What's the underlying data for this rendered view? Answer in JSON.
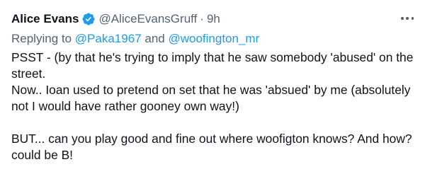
{
  "tweet": {
    "display_name": "Alice Evans",
    "handle": "@AliceEvansGruff",
    "separator": "·",
    "time": "9h",
    "reply_prefix": "Replying to",
    "reply_mention_1": "@Paka1967",
    "reply_and": "and",
    "reply_mention_2": "@woofington_mr",
    "paragraphs": [
      "PSST  - (by that he's trying to imply that he saw somebody 'abused' on the street.",
      "Now.. Ioan used to pretend on set that he was 'absued' by me (absolutely not I would have rather gooney own way!)",
      "BUT... can you play good and fine out where woofigton knows? And how? could be B!"
    ]
  },
  "icons": {
    "verified": "verified-badge-icon",
    "more": "more-options-icon"
  },
  "colors": {
    "text": "#0f1419",
    "secondary": "#536471",
    "accent": "#1d9bf0"
  }
}
